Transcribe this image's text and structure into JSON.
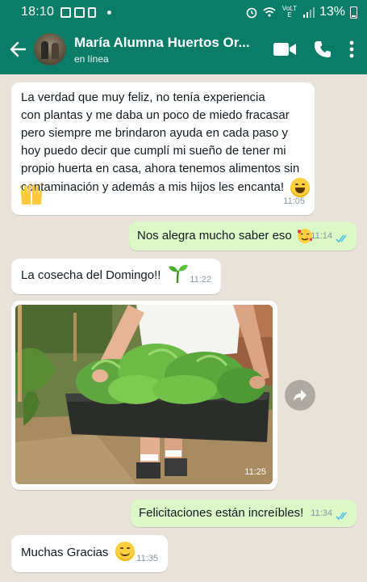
{
  "status_bar": {
    "time": "18:10",
    "battery": "13%",
    "network": "VoLTE"
  },
  "app_bar": {
    "contact_name": "María Alumna Huertos Or...",
    "contact_status": "en línea",
    "icons": [
      "back-arrow-icon",
      "avatar",
      "video-call-icon",
      "phone-icon",
      "more-vert-icon"
    ]
  },
  "colors": {
    "header": "#0a7d68",
    "chat_background": "#e9e2d8",
    "incoming": "#ffffff",
    "outgoing": "#dcf8c6",
    "read_ticks": "#53bdeb"
  },
  "messages": [
    {
      "direction": "in",
      "lines": [
        "La verdad que muy feliz, no tenía experiencia",
        "con plantas y me daba un poco de miedo fracasar",
        "pero siempre me brindaron ayuda en cada paso y",
        "hoy puedo decir que cumplí mi sueño de tener mi",
        "propio huerta en casa, ahora tenemos alimentos sin",
        "contaminación y además a mis hijos les encanta!"
      ],
      "emoji": "😄 🙌",
      "time": "11:05"
    },
    {
      "direction": "out",
      "text": "Nos alegra mucho saber eso",
      "emoji": "🥰",
      "time": "11:14",
      "status": "read"
    },
    {
      "direction": "in",
      "text": "La cosecha del Domingo!!",
      "emoji": "🌱",
      "time": "11:22"
    },
    {
      "direction": "in",
      "type": "image",
      "alt": "vegetables-in-tray",
      "time": "11:25"
    },
    {
      "direction": "out",
      "text": "Felicitaciones están increíbles!",
      "time": "11:34",
      "status": "read"
    },
    {
      "direction": "in",
      "text": "Muchas Gracias",
      "emoji": "😊",
      "time": "11:35"
    }
  ]
}
